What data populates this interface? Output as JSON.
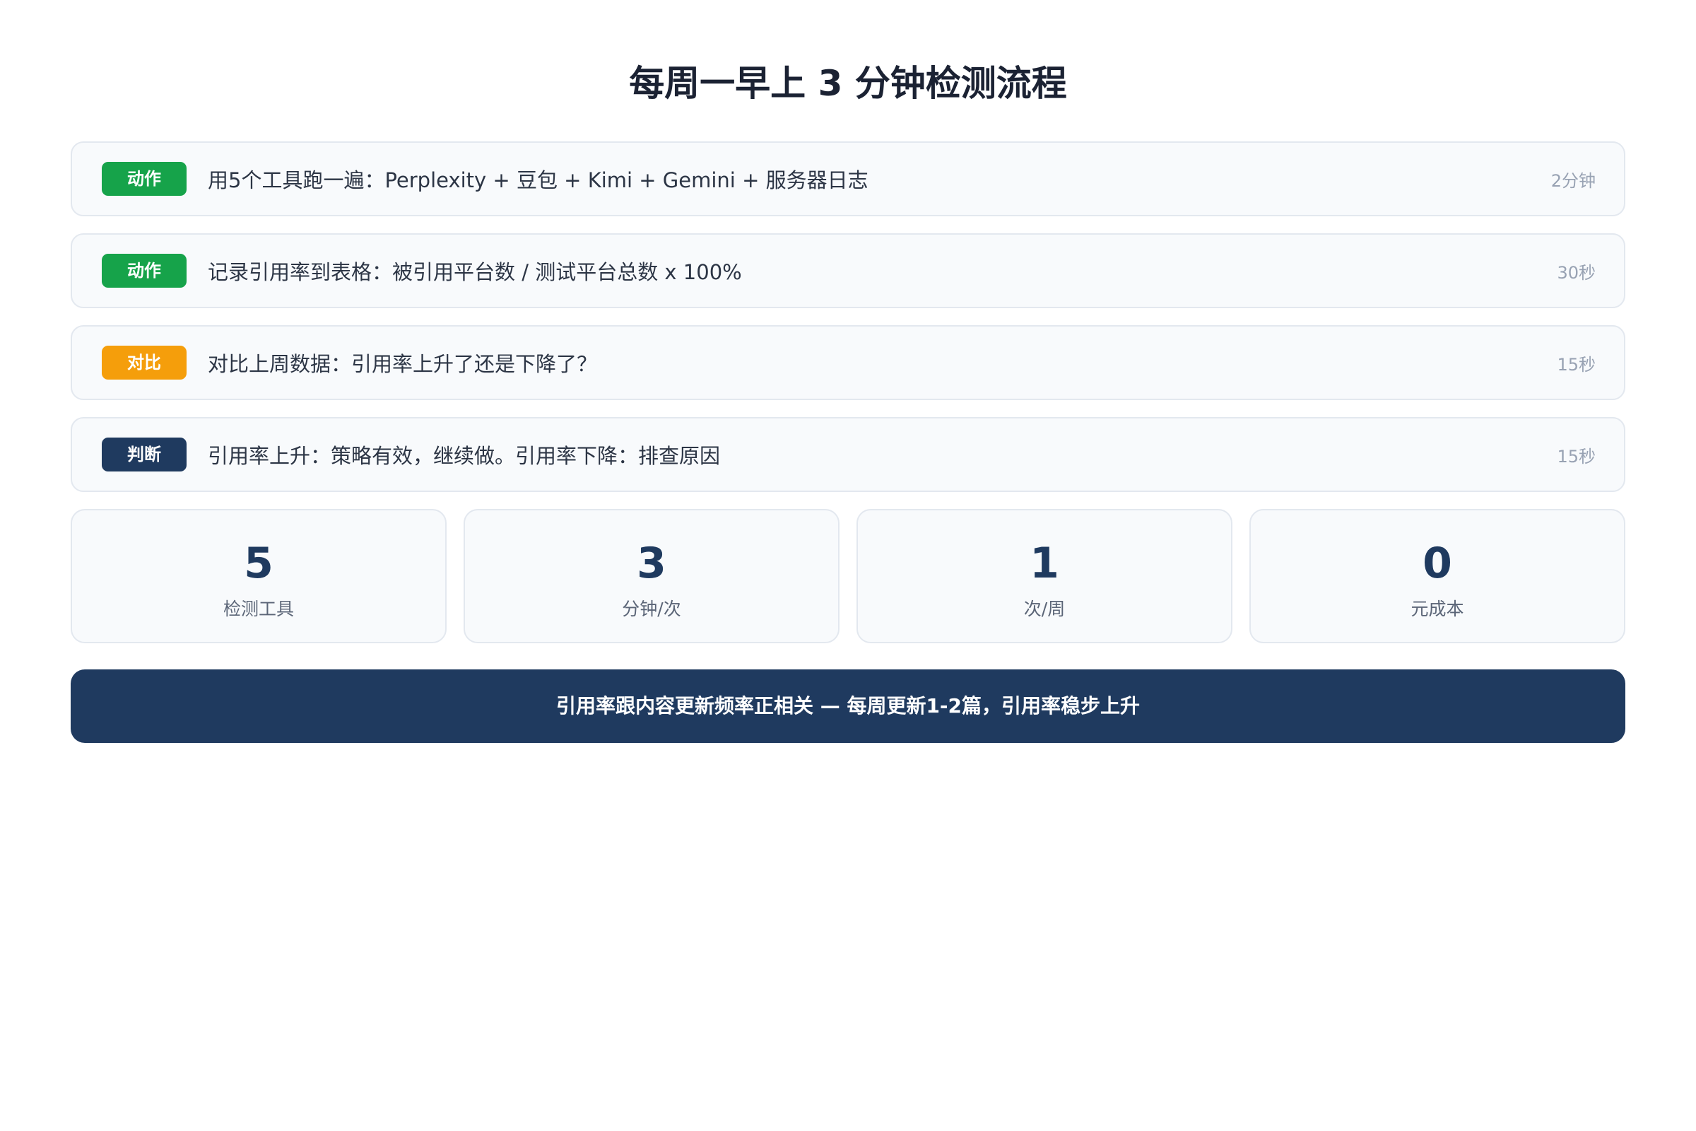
{
  "title": "每周一早上 3 分钟检测流程",
  "steps": [
    {
      "badge": "动作",
      "badge_color": "#16a34a",
      "text": "用5个工具跑一遍：Perplexity + 豆包 + Kimi + Gemini + 服务器日志",
      "time": "2分钟"
    },
    {
      "badge": "动作",
      "badge_color": "#16a34a",
      "text": "记录引用率到表格：被引用平台数 / 测试平台总数 x 100%",
      "time": "30秒"
    },
    {
      "badge": "对比",
      "badge_color": "#f59e0b",
      "text": "对比上周数据：引用率上升了还是下降了？",
      "time": "15秒"
    },
    {
      "badge": "判断",
      "badge_color": "#1f3a5f",
      "text": "引用率上升：策略有效，继续做。引用率下降：排查原因",
      "time": "15秒"
    }
  ],
  "stats": [
    {
      "value": "5",
      "label": "检测工具"
    },
    {
      "value": "3",
      "label": "分钟/次"
    },
    {
      "value": "1",
      "label": "次/周"
    },
    {
      "value": "0",
      "label": "元成本"
    }
  ],
  "banner": "引用率跟内容更新频率正相关 — 每周更新1-2篇，引用率稳步上升",
  "colors": {
    "navy": "#1f3a5f",
    "green": "#16a34a",
    "amber": "#f59e0b"
  }
}
